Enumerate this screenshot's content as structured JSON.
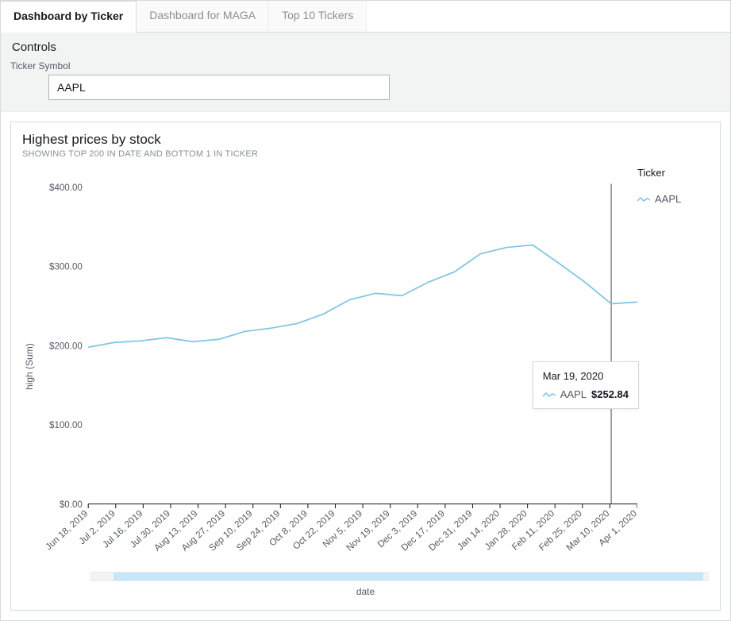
{
  "tabs": [
    {
      "label": "Dashboard by Ticker",
      "active": true
    },
    {
      "label": "Dashboard for MAGA",
      "active": false
    },
    {
      "label": "Top 10 Tickers",
      "active": false
    }
  ],
  "controls": {
    "heading": "Controls",
    "ticker_label": "Ticker Symbol",
    "ticker_value": "AAPL"
  },
  "chart": {
    "title": "Highest prices by stock",
    "subtitle": "SHOWING TOP 200 IN DATE AND BOTTOM 1 IN TICKER",
    "y_axis_label": "high (Sum)",
    "x_axis_label": "date",
    "legend_title": "Ticker",
    "legend_items": [
      "AAPL"
    ],
    "tooltip": {
      "date": "Mar 19, 2020",
      "series": "AAPL",
      "value": "$252.84"
    }
  },
  "chart_data": {
    "type": "line",
    "title": "Highest prices by stock",
    "xlabel": "date",
    "ylabel": "high (Sum)",
    "ylim": [
      0,
      400
    ],
    "y_ticks": [
      "$0.00",
      "$100.00",
      "$200.00",
      "$300.00",
      "$400.00"
    ],
    "x_tick_labels": [
      "Jun 18, 2019",
      "Jul 2, 2019",
      "Jul 16, 2019",
      "Jul 30, 2019",
      "Aug 13, 2019",
      "Aug 27, 2019",
      "Sep 10, 2019",
      "Sep 24, 2019",
      "Oct 8, 2019",
      "Oct 22, 2019",
      "Nov 5, 2019",
      "Nov 19, 2019",
      "Dec 3, 2019",
      "Dec 17, 2019",
      "Dec 31, 2019",
      "Jan 14, 2020",
      "Jan 28, 2020",
      "Feb 11, 2020",
      "Feb 25, 2020",
      "Mar 10, 2020",
      "Apr 1, 2020"
    ],
    "series": [
      {
        "name": "AAPL",
        "color": "#7cc5e6",
        "x": [
          "Jun 18, 2019",
          "Jul 2, 2019",
          "Jul 16, 2019",
          "Jul 30, 2019",
          "Aug 13, 2019",
          "Aug 27, 2019",
          "Sep 10, 2019",
          "Sep 24, 2019",
          "Oct 8, 2019",
          "Oct 22, 2019",
          "Nov 5, 2019",
          "Nov 19, 2019",
          "Dec 3, 2019",
          "Dec 17, 2019",
          "Dec 31, 2019",
          "Jan 14, 2020",
          "Jan 28, 2020",
          "Feb 11, 2020",
          "Feb 25, 2020",
          "Mar 10, 2020",
          "Mar 19, 2020",
          "Apr 1, 2020"
        ],
        "values": [
          198,
          204,
          206,
          210,
          205,
          208,
          218,
          222,
          228,
          240,
          258,
          266,
          263,
          280,
          293,
          316,
          324,
          327,
          304,
          280,
          252.84,
          255
        ]
      }
    ],
    "highlight": {
      "x": "Mar 19, 2020",
      "series": "AAPL",
      "value": 252.84
    }
  }
}
